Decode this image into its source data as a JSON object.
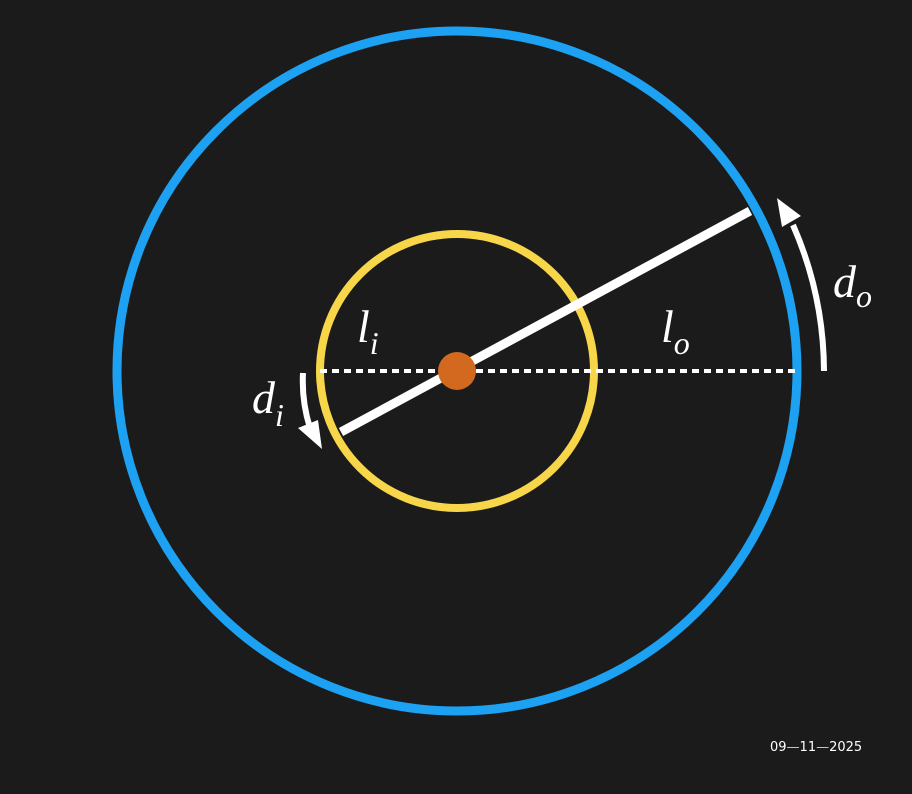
{
  "colors": {
    "background": "#1b1b1b",
    "outer_circle": "#1da1f2",
    "inner_circle": "#f7d64a",
    "center_dot": "#d2691e",
    "lever": "#ffffff",
    "dotted_line": "#ffffff",
    "arrow": "#ffffff",
    "date_text": "#ffffff",
    "date_dash": "#f7d64a"
  },
  "labels": {
    "l_inner": {
      "base": "l",
      "sub": "i"
    },
    "l_outer": {
      "base": "l",
      "sub": "o"
    },
    "d_inner": {
      "base": "d",
      "sub": "i"
    },
    "d_outer": {
      "base": "d",
      "sub": "o"
    }
  },
  "date": {
    "day": "09",
    "month": "11",
    "year": "2025",
    "separator": "—"
  }
}
